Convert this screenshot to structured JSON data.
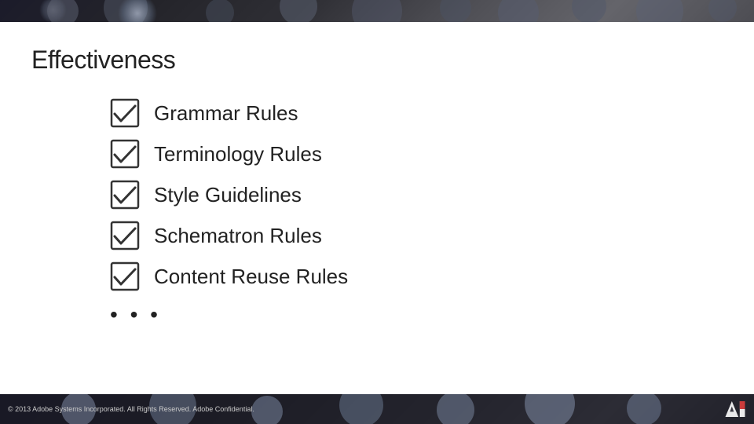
{
  "page": {
    "title": "Effectiveness",
    "background_color": "#ffffff"
  },
  "checklist": {
    "items": [
      {
        "id": "grammar-rules",
        "label": "Grammar Rules",
        "checked": true
      },
      {
        "id": "terminology-rules",
        "label": "Terminology Rules",
        "checked": true
      },
      {
        "id": "style-guidelines",
        "label": "Style Guidelines",
        "checked": true
      },
      {
        "id": "schematron-rules",
        "label": "Schematron Rules",
        "checked": true
      },
      {
        "id": "content-reuse-rules",
        "label": "Content Reuse Rules",
        "checked": true
      }
    ],
    "ellipsis": "• • •"
  },
  "footer": {
    "copyright": "© 2013 Adobe Systems Incorporated. All Rights Reserved. Adobe Confidential."
  },
  "colors": {
    "title": "#222222",
    "item_text": "#222222",
    "checkbox_border": "#333333",
    "checkmark": "#333333"
  }
}
